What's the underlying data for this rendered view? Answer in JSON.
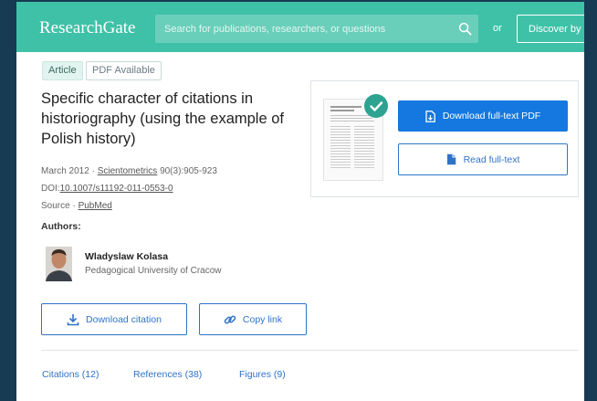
{
  "header": {
    "logo": "ResearchGate",
    "search_placeholder": "Search for publications, researchers, or questions",
    "or_label": "or",
    "discover_label": "Discover by s"
  },
  "article": {
    "badges": [
      "Article",
      "PDF Available"
    ],
    "title": "Specific character of citations in historiography (using the example of Polish history)",
    "date": "March 2012",
    "journal": "Scientometrics",
    "volume": "90(3):905-923",
    "doi_label": "DOI:",
    "doi": "10.1007/s11192-011-0553-0",
    "source_label": "Source",
    "source": "PubMed"
  },
  "authors": {
    "label": "Authors:",
    "items": [
      {
        "name": "Wladyslaw Kolasa",
        "institution": "Pedagogical University of Cracow"
      }
    ]
  },
  "actions": {
    "download_citation": "Download citation",
    "copy_link": "Copy link",
    "download_pdf": "Download full-text PDF",
    "read_fulltext": "Read full-text"
  },
  "tabs": [
    "Citations (12)",
    "References (38)",
    "Figures (9)"
  ],
  "colors": {
    "brand": "#3fc1a8",
    "primary_blue": "#1478e0",
    "link_blue": "#2f73c8",
    "check_green": "#2ea391"
  }
}
